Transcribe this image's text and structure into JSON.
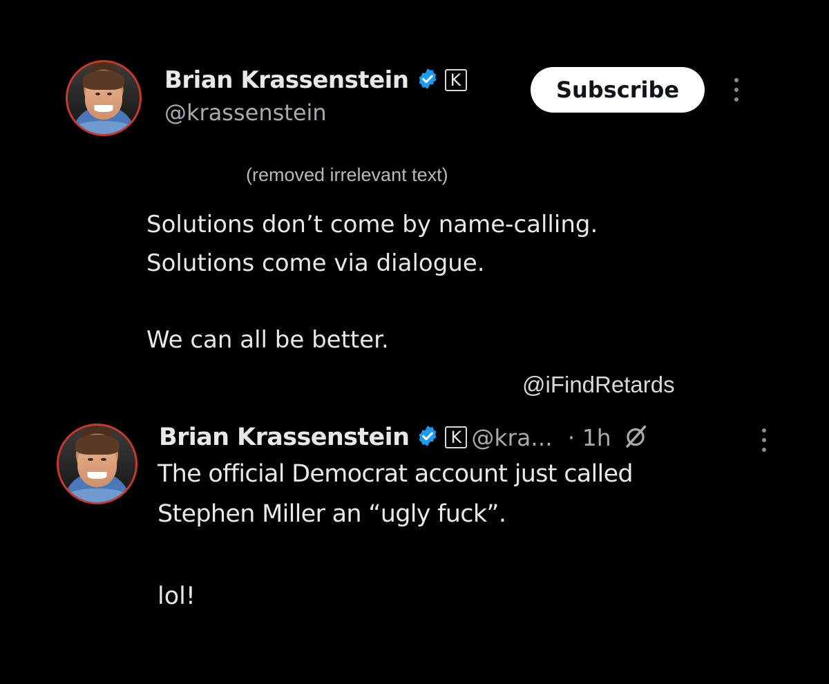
{
  "post": {
    "author": {
      "display_name": "Brian Krassenstein",
      "handle": "@krassenstein",
      "badge_letter": "K"
    },
    "subscribe_label": "Subscribe",
    "removed_note": "(removed irrelevant text)",
    "text_lines": [
      "Solutions don’t come by name-calling.",
      "Solutions come via dialogue.",
      "We can all be better."
    ]
  },
  "watermark": "@iFindRetards",
  "quoted": {
    "author": {
      "display_name": "Brian Krassenstein",
      "handle_truncated": "@kra...",
      "badge_letter": "K"
    },
    "time": "· 1h",
    "text_lines": [
      "The official Democrat account just called",
      "Stephen Miller an “ugly fuck”.",
      "lol!"
    ]
  },
  "colors": {
    "background": "#000000",
    "text": "#e7e9ea",
    "muted": "#a7abb0",
    "verified": "#1d9bf0",
    "avatar_ring": "#c43a2c"
  },
  "icons": {
    "verified": "verified-badge-icon",
    "menu": "more-vertical-icon",
    "grok": "grok-slash-icon"
  }
}
